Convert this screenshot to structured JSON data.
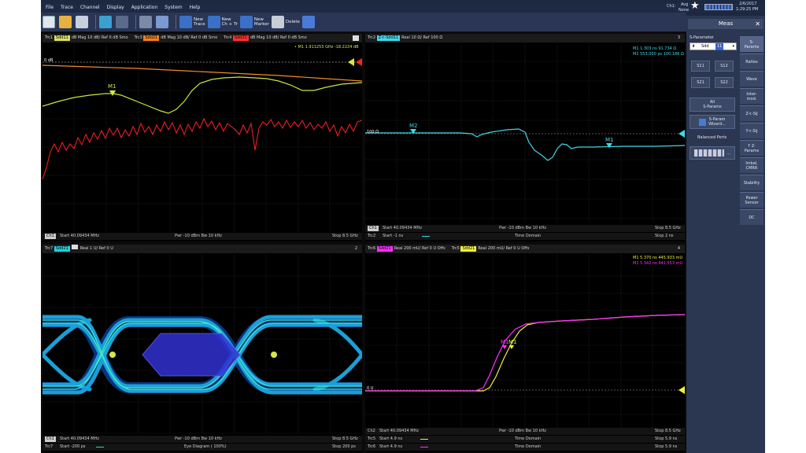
{
  "menu": [
    "File",
    "Trace",
    "Channel",
    "Display",
    "Application",
    "System",
    "Help"
  ],
  "status": {
    "channel": "Ch1:",
    "avg_line1": "Avg",
    "avg_line2": "None",
    "date": "2/6/2017",
    "time": "1:29:25 PM"
  },
  "toolbar": {
    "new_trace": [
      "New",
      "Trace"
    ],
    "new_ch_tr": [
      "New",
      "Ch + Tr"
    ],
    "new_marker": [
      "New",
      "Marker"
    ],
    "delete": "Delete"
  },
  "pane1": {
    "header": [
      {
        "label": "Trc1",
        "tag": "Sdd11",
        "color": "#d8e060",
        "text": "dB Mag 10 dB/ Ref 0 dB Smo"
      },
      {
        "label": "Trc3",
        "tag": "Sdd21",
        "color": "#f08020",
        "text": "dB Mag 10 dB/ Ref 0 dB Smo"
      },
      {
        "label": "Trc4",
        "tag": "Sdd31",
        "color": "#ff3030",
        "text": "dB Mag 10 dB/ Ref 0 dB Smo"
      }
    ],
    "marker_readout": "• M1  1.911253 GHz  -18.2224 dB",
    "ref_label": "0 dB",
    "marker": "M1",
    "footer": {
      "ch": "Ch1",
      "start": "Start 40.09434 MHz",
      "pwr": "Pwr -10 dBm  Bw 10 kHz",
      "stop": "Stop 8.5 GHz"
    }
  },
  "pane2": {
    "header": {
      "label": "Trc2",
      "tag": "Z<-Sdd11",
      "color": "#40d8e8",
      "text": "Real  10 Ω/ Ref 100 Ω"
    },
    "num": "3",
    "m1": "M1   1.303 ns   91.734 Ω",
    "m2": "M2   553.000 ps  100.186 Ω",
    "ref_label": "100 Ω",
    "markers": [
      "M2",
      "M1"
    ],
    "footer": {
      "ch": "Ch1",
      "start": "Start 40.09434 MHz",
      "pwr": "Pwr -10 dBm  Bw 10 kHz",
      "stop": "Stop 8.5 GHz",
      "trc": "Trc2",
      "tstart": "Start -1 ns",
      "time": "Time  Domain",
      "tstop": "Stop 2 ns"
    }
  },
  "pane3": {
    "header": {
      "label": "Trc7",
      "tag": "Sdd21",
      "color": "#20d0e0",
      "text": "Real  1 U/ Ref 0 U"
    },
    "num": "2",
    "footer": {
      "ch": "Ch1",
      "start": "Start 40.09434 MHz",
      "pwr": "Pwr -10 dBm  Bw 10 kHz",
      "stop": "Stop 8.5 GHz",
      "trc": "Trc7",
      "tstart": "Start -200 ps",
      "eye": "Eye Diagram ( 100%)",
      "tstop": "Stop 200 ps"
    }
  },
  "pane4": {
    "header": [
      {
        "label": "Trc6",
        "tag": "Sdd21",
        "color": "#ff30ff",
        "text": "Real  200 mU/ Ref 0 U  Offs"
      },
      {
        "label": "Trc5",
        "tag": "Sdd21",
        "color": "#f0f040",
        "text": "Real  200 mU/ Ref 0 U  Offs"
      }
    ],
    "num": "4",
    "m1a": "M1  5.370  ns  445.933  mU",
    "m1b": "M1  5.342  ns  441.553  mU",
    "ref_label": "0 U",
    "markers": [
      "M1",
      "M1"
    ],
    "footer": {
      "ch": "Ch2",
      "start": "Start 40.09434 MHz",
      "pwr": "Pwr -10 dBm  Bw 10 kHz",
      "stop": "Stop 8.5 GHz",
      "trc5": "Trc5",
      "t5start": "Start 4.9 ns",
      "time": "Time  Domain",
      "t5stop": "Stop 5.9 ns",
      "trc6": "Trc6",
      "t6start": "Start 4.9 ns",
      "t6stop": "Stop 5.9 ns"
    }
  },
  "rpanel": {
    "title": "Meas",
    "sparam_label": "S-Parameter",
    "sdd_value": "Sdd",
    "sdd_index": "11",
    "buttons": [
      "S11",
      "S12",
      "S21",
      "S22"
    ],
    "all_sparams": [
      "All",
      "S-Params"
    ],
    "wizard": [
      "S-Param",
      "Wizard..."
    ],
    "balanced": "Balanced Ports",
    "tabs": [
      [
        "S-",
        "Params"
      ],
      [
        "Ratios"
      ],
      [
        "Wave"
      ],
      [
        "Inter-",
        "mod."
      ],
      [
        "Z<-Sij"
      ],
      [
        "Y<-Sij"
      ],
      [
        "Y Z-",
        "Params"
      ],
      [
        "Imbal.",
        "CMRR"
      ],
      [
        "Stability"
      ],
      [
        "Power",
        "Sensor"
      ],
      [
        "DC"
      ]
    ]
  }
}
